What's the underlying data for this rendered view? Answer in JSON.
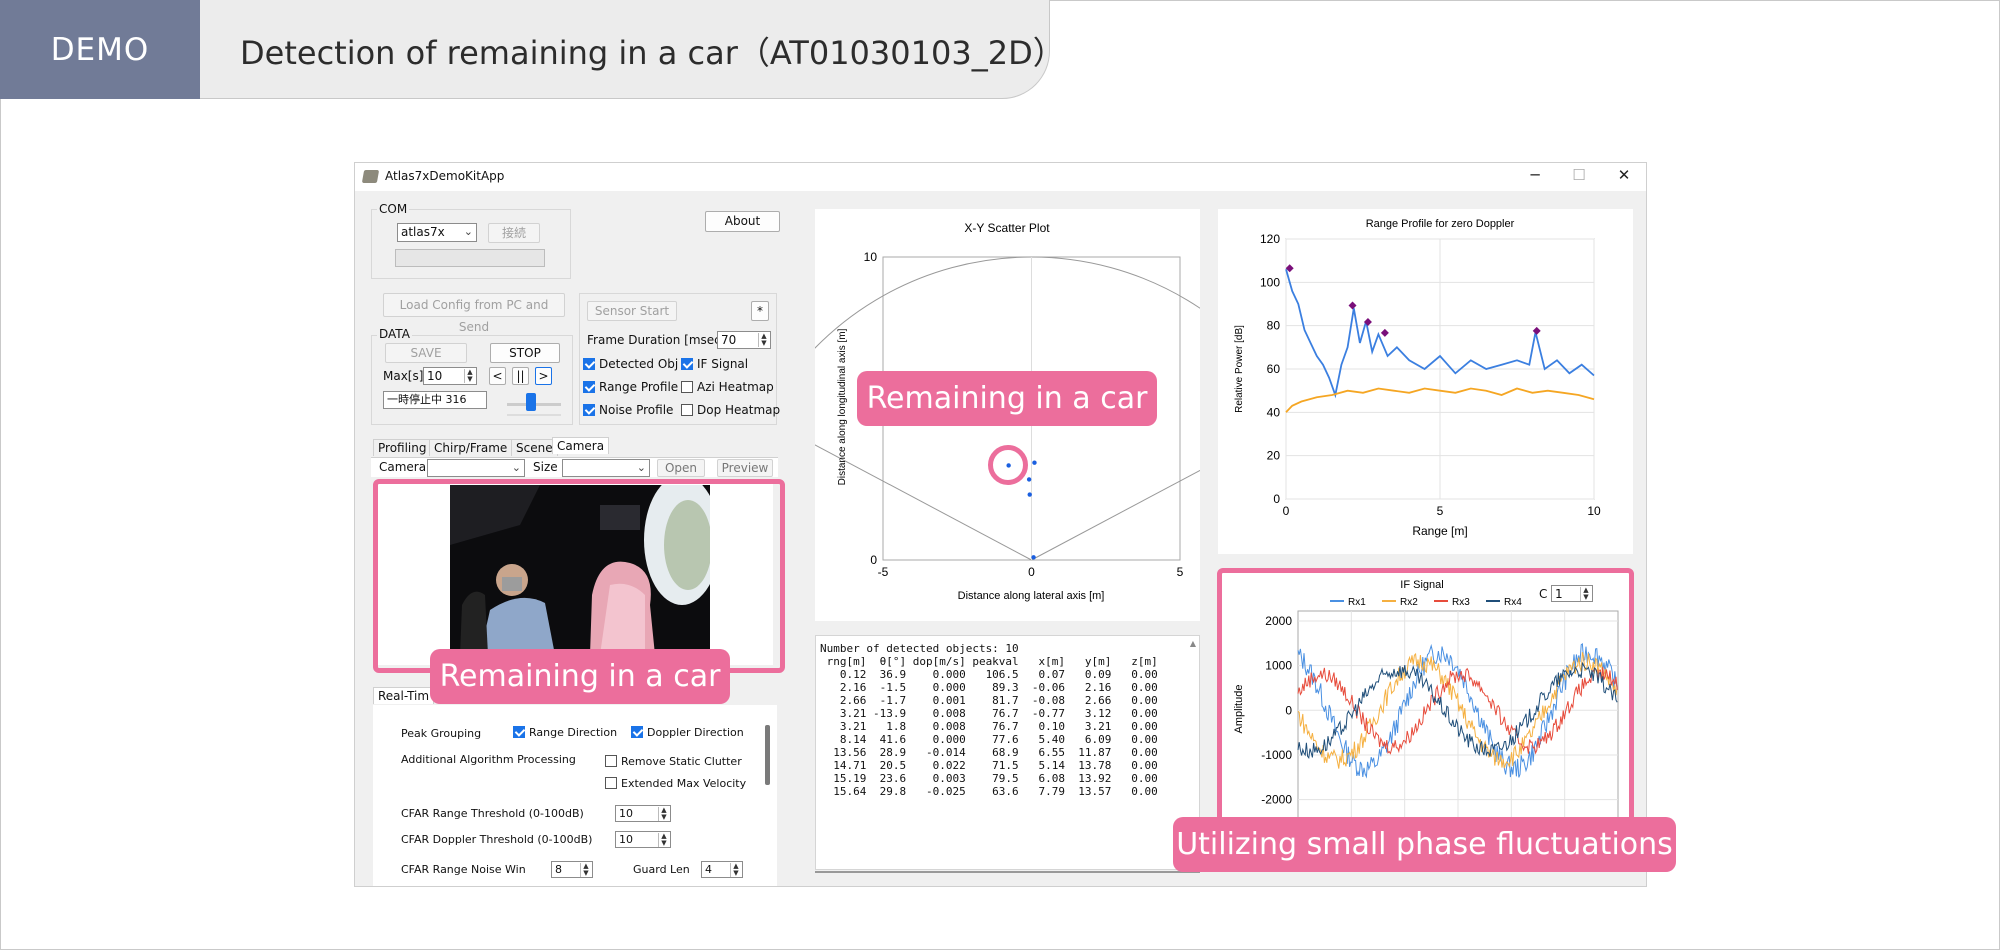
{
  "slide": {
    "tag": "DEMO",
    "title": "Detection of remaining in a car（AT01030103_2D）"
  },
  "window": {
    "title": "Atlas7xDemoKitApp",
    "controls": {
      "minimize": "─",
      "maximize": "☐",
      "close": "✕"
    }
  },
  "com": {
    "group_label": "COM",
    "port_value": "atlas7x",
    "connect_label": "接続",
    "about_label": "About"
  },
  "config": {
    "load_label": "Load Config from PC and Send",
    "sensor_start_label": "Sensor Start",
    "star_label": "*",
    "frame_duration_label": "Frame Duration [msec]",
    "frame_duration_value": "70",
    "checks": [
      {
        "label": "Detected Obj",
        "checked": true
      },
      {
        "label": "IF Signal",
        "checked": true
      },
      {
        "label": "Range Profile",
        "checked": true
      },
      {
        "label": "Azi Heatmap",
        "checked": false
      },
      {
        "label": "Noise Profile",
        "checked": true
      },
      {
        "label": "Dop Heatmap",
        "checked": false
      }
    ]
  },
  "data_group": {
    "label": "DATA",
    "save_label": "SAVE",
    "stop_label": "STOP",
    "max_label": "Max[s]",
    "max_value": "10",
    "prev_label": "<",
    "pause_label": "||",
    "next_label": ">",
    "status_text": "一時停止中 316",
    "slider_level": 0.45
  },
  "tabs": [
    "Profiling",
    "Chirp/Frame",
    "Scene",
    "Camera"
  ],
  "camera": {
    "camera_label": "Camera",
    "size_label": "Size",
    "open_label": "Open",
    "preview_label": "Preview"
  },
  "realtime": {
    "tab_label": "Real-Tim",
    "peak_grouping": "Peak Grouping",
    "range_direction": "Range Direction",
    "doppler_direction": "Doppler Direction",
    "additional": "Additional Algorithm Processing",
    "remove_static": "Remove Static Clutter",
    "extended_max": "Extended Max Velocity",
    "cfar_range": "CFAR Range Threshold (0-100dB)",
    "cfar_range_value": "10",
    "cfar_doppler": "CFAR Doppler Threshold (0-100dB)",
    "cfar_doppler_value": "10",
    "cfar_noise": "CFAR Range Noise Win",
    "cfar_noise_value": "8",
    "guard_len": "Guard Len",
    "guard_len_value": "4"
  },
  "labels": {
    "remaining1": "Remaining in a car",
    "remaining2": "Remaining in a car",
    "phase": "Utilizing small phase fluctuations"
  },
  "table": {
    "header_line": "Number of detected objects: 10",
    "columns": [
      "rng[m]",
      "θ[°]",
      "dop[m/s]",
      "peakval",
      "x[m]",
      "y[m]",
      "z[m]"
    ],
    "rows": [
      [
        "0.12",
        "36.9",
        "0.000",
        "106.5",
        "0.07",
        "0.09",
        "0.00"
      ],
      [
        "2.16",
        "-1.5",
        "0.000",
        "89.3",
        "-0.06",
        "2.16",
        "0.00"
      ],
      [
        "2.66",
        "-1.7",
        "0.001",
        "81.7",
        "-0.08",
        "2.66",
        "0.00"
      ],
      [
        "3.21",
        "-13.9",
        "0.008",
        "76.7",
        "-0.77",
        "3.12",
        "0.00"
      ],
      [
        "3.21",
        "1.8",
        "0.008",
        "76.7",
        "0.10",
        "3.21",
        "0.00"
      ],
      [
        "8.14",
        "41.6",
        "0.000",
        "77.6",
        "5.40",
        "6.09",
        "0.00"
      ],
      [
        "13.56",
        "28.9",
        "-0.014",
        "68.9",
        "6.55",
        "11.87",
        "0.00"
      ],
      [
        "14.71",
        "20.5",
        "0.022",
        "71.5",
        "5.14",
        "13.78",
        "0.00"
      ],
      [
        "15.19",
        "23.6",
        "0.003",
        "79.5",
        "6.08",
        "13.92",
        "0.00"
      ],
      [
        "15.64",
        "29.8",
        "-0.025",
        "63.6",
        "7.79",
        "13.57",
        "0.00"
      ]
    ]
  },
  "chart_data": [
    {
      "type": "scatter",
      "title": "X-Y Scatter Plot",
      "xlabel": "Distance along lateral axis [m]",
      "ylabel": "Distance along longitudinal axis [m]",
      "xlim": [
        -5,
        5
      ],
      "ylim": [
        0,
        10
      ],
      "xticks": [
        "-5",
        "0",
        "5"
      ],
      "yticks": [
        "0",
        "10"
      ],
      "points": [
        [
          0.07,
          0.09
        ],
        [
          -0.06,
          2.16
        ],
        [
          -0.08,
          2.66
        ],
        [
          -0.77,
          3.12
        ],
        [
          0.1,
          3.21
        ]
      ],
      "color": "#1a5fe0"
    },
    {
      "type": "line",
      "title": "Range Profile for zero Doppler",
      "xlabel": "Range [m]",
      "ylabel": "Relative Power [dB]",
      "xlim": [
        0,
        10
      ],
      "ylim": [
        0,
        120
      ],
      "xticks": [
        "0",
        "5",
        "10"
      ],
      "yticks": [
        "0",
        "20",
        "40",
        "60",
        "80",
        "100",
        "120"
      ],
      "series": [
        {
          "color": "#3b7fe0",
          "x": [
            0,
            0.2,
            0.4,
            0.6,
            0.8,
            1.0,
            1.2,
            1.4,
            1.6,
            1.8,
            2.0,
            2.2,
            2.4,
            2.6,
            2.8,
            3.0,
            3.3,
            3.6,
            4.0,
            4.5,
            5.0,
            5.5,
            6.0,
            6.5,
            7.0,
            7.5,
            7.9,
            8.1,
            8.4,
            8.8,
            9.2,
            9.6,
            10.0
          ],
          "y": [
            106,
            96,
            90,
            78,
            72,
            66,
            62,
            56,
            48,
            62,
            70,
            88,
            72,
            82,
            68,
            76,
            66,
            70,
            64,
            60,
            66,
            58,
            64,
            60,
            62,
            64,
            62,
            77,
            60,
            64,
            58,
            62,
            57
          ]
        },
        {
          "color": "#f5a623",
          "x": [
            0,
            0.2,
            0.5,
            1.0,
            1.5,
            2.0,
            2.5,
            3.0,
            3.5,
            4.0,
            4.5,
            5.0,
            5.5,
            6.0,
            6.5,
            7.0,
            7.5,
            8.0,
            8.5,
            9.0,
            9.5,
            10.0
          ],
          "y": [
            40,
            43,
            45,
            47,
            48,
            50,
            49,
            51,
            50,
            49,
            51,
            50,
            49,
            51,
            50,
            48,
            51,
            49,
            50,
            49,
            48,
            46
          ]
        }
      ],
      "peaks": [
        [
          0.12,
          106.5
        ],
        [
          2.16,
          89.3
        ],
        [
          2.66,
          81.7
        ],
        [
          3.21,
          76.7
        ],
        [
          8.14,
          77.6
        ]
      ]
    },
    {
      "type": "line",
      "title": "IF Signal",
      "ylabel": "Amplitude",
      "ylim": [
        -2000,
        2000
      ],
      "yticks": [
        "2000",
        "1000",
        "0",
        "-1000",
        "-2000"
      ],
      "legend": [
        "Rx1",
        "Rx2",
        "Rx3",
        "Rx4"
      ],
      "legend_placement": "top",
      "channel_label": "C",
      "channel_value": "1",
      "series": [
        {
          "name": "Rx1",
          "color": "#4a90e2"
        },
        {
          "name": "Rx2",
          "color": "#f5b041"
        },
        {
          "name": "Rx3",
          "color": "#e74c3c"
        },
        {
          "name": "Rx4",
          "color": "#1f4e79"
        }
      ]
    }
  ]
}
